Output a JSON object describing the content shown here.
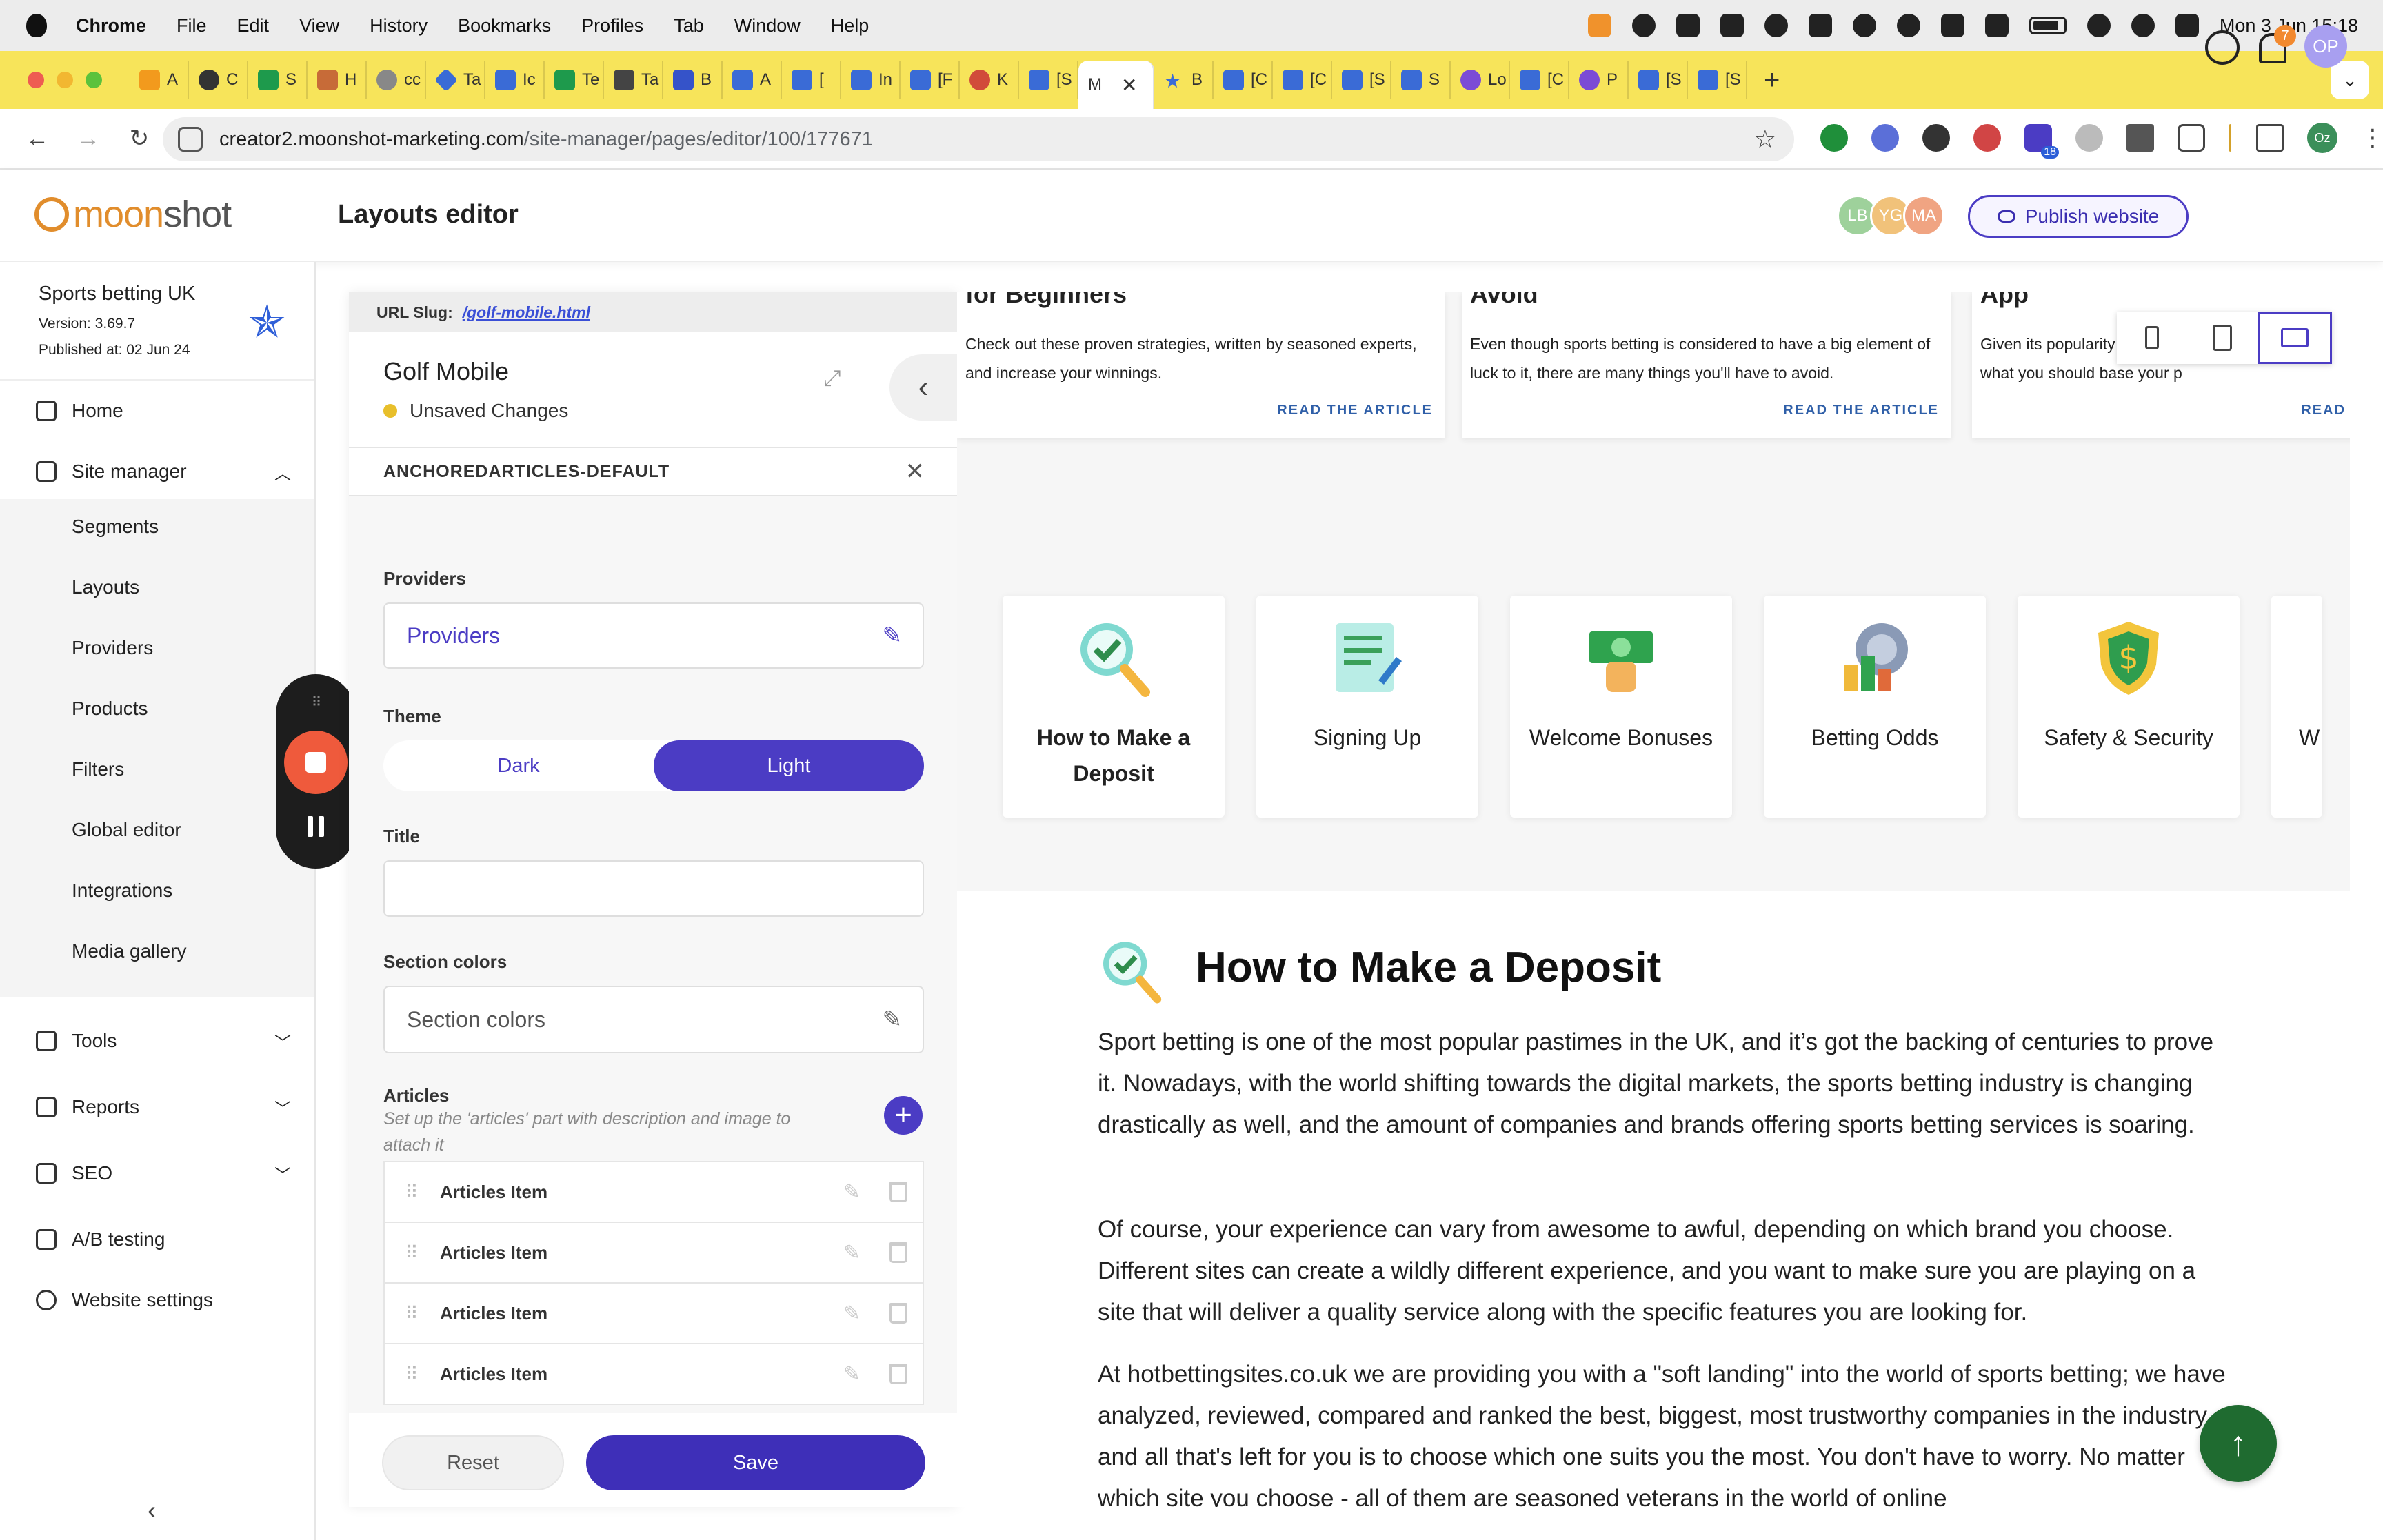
{
  "menubar": {
    "app": "Chrome",
    "items": [
      "File",
      "Edit",
      "View",
      "History",
      "Bookmarks",
      "Profiles",
      "Tab",
      "Window",
      "Help"
    ],
    "clock": "Mon 3 Jun  15:18"
  },
  "tabs": [
    {
      "label": "A",
      "icon": "bar-chart-icon"
    },
    {
      "label": "C",
      "icon": "openai-icon"
    },
    {
      "label": "S",
      "icon": "sheets-icon"
    },
    {
      "label": "H",
      "icon": "figure-icon"
    },
    {
      "label": "cc",
      "icon": "circle-icon"
    },
    {
      "label": "Ta",
      "icon": "diamond-icon"
    },
    {
      "label": "Ic",
      "icon": "jira-icon"
    },
    {
      "label": "Te",
      "icon": "sheets-icon"
    },
    {
      "label": "Ta",
      "icon": "doc-icon"
    },
    {
      "label": "B",
      "icon": "stack-icon"
    },
    {
      "label": "A",
      "icon": "jira-icon"
    },
    {
      "label": "[",
      "icon": "jira-icon"
    },
    {
      "label": "In",
      "icon": "jira-icon"
    },
    {
      "label": "[F",
      "icon": "jira-icon"
    },
    {
      "label": "K",
      "icon": "record-icon"
    },
    {
      "label": "[S",
      "icon": "jira-icon"
    },
    {
      "label": "M",
      "icon": "moonshot-icon",
      "active": true
    },
    {
      "label": "B",
      "icon": "star-icon"
    },
    {
      "label": "[C",
      "icon": "jira-icon"
    },
    {
      "label": "[C",
      "icon": "jira-icon"
    },
    {
      "label": "[S",
      "icon": "jira-icon"
    },
    {
      "label": "S",
      "icon": "jira-icon"
    },
    {
      "label": "Lo",
      "icon": "google-icon"
    },
    {
      "label": "[C",
      "icon": "jira-icon"
    },
    {
      "label": "P",
      "icon": "google-icon"
    },
    {
      "label": "[S",
      "icon": "jira-icon"
    },
    {
      "label": "[S",
      "icon": "jira-icon"
    }
  ],
  "address": {
    "host": "creator2.moonshot-marketing.com",
    "path": "/site-manager/pages/editor/100/177671"
  },
  "header": {
    "logo_a": "moon",
    "logo_b": "shot",
    "title": "Layouts editor",
    "collaborators": [
      "LB",
      "YG",
      "MA"
    ],
    "publish_label": "Publish website",
    "notifications": "7",
    "user_initials": "OP",
    "extension_badge": "18",
    "profile_chip": "Oz"
  },
  "sidebar": {
    "site_name": "Sports betting UK",
    "version": "Version: 3.69.7",
    "published": "Published at: 02 Jun 24",
    "items": {
      "home": "Home",
      "site_manager": "Site manager",
      "tools": "Tools",
      "reports": "Reports",
      "seo": "SEO",
      "ab": "A/B testing",
      "settings": "Website settings"
    },
    "sub_items": [
      "Segments",
      "Layouts",
      "Providers",
      "Products",
      "Filters",
      "Global editor",
      "Integrations",
      "Media gallery"
    ]
  },
  "editor": {
    "slug_label": "URL Slug:",
    "slug_value": "/golf-mobile.html",
    "layout_name": "Golf Mobile",
    "status": "Unsaved Changes",
    "component": "ANCHOREDARTICLES-DEFAULT",
    "providers_label": "Providers",
    "providers_value": "Providers",
    "theme_label": "Theme",
    "theme_dark": "Dark",
    "theme_light": "Light",
    "title_label": "Title",
    "title_value": "",
    "section_colors_label": "Section colors",
    "section_colors_value": "Section colors",
    "articles_label": "Articles",
    "articles_hint": "Set up the 'articles' part with description and image to attach it",
    "article_items": [
      "Articles Item",
      "Articles Item",
      "Articles Item",
      "Articles Item"
    ],
    "reset_label": "Reset",
    "save_label": "Save"
  },
  "preview": {
    "cards": [
      {
        "head": "for Beginners",
        "desc": "Check out these proven strategies, written by seasoned experts, and increase your winnings.",
        "link": "READ THE ARTICLE"
      },
      {
        "head": "Avoid",
        "desc": "Even though sports betting is considered to have a big element of luck to it, there are many things you'll have to avoid.",
        "link": "READ THE ARTICLE"
      },
      {
        "head": "App",
        "desc": "Given its popularity ... it is e Check this out to see what you should base your p",
        "link": "READ"
      }
    ],
    "categories": [
      {
        "label": "How to Make a Deposit",
        "icon": "magnifier-check-icon",
        "selected": true
      },
      {
        "label": "Signing Up",
        "icon": "form-pencil-icon"
      },
      {
        "label": "Welcome Bonuses",
        "icon": "hand-cash-icon"
      },
      {
        "label": "Betting Odds",
        "icon": "ball-chart-icon"
      },
      {
        "label": "Safety & Security",
        "icon": "dollar-shield-icon"
      },
      {
        "label": "W",
        "icon": "partial-icon"
      }
    ],
    "heading": "How to Make a Deposit",
    "paragraphs": [
      "Sport betting is one of the most popular pastimes in the UK, and it’s got the backing of centuries to prove it. Nowadays, with the world shifting towards the digital markets, the sports betting industry is changing drastically as well, and the amount of companies and brands offering sports betting services is soaring.",
      "Of course, your experience can vary from awesome to awful, depending on which brand you choose. Different sites can create a wildly different experience, and you want to make sure you are playing on a site that will deliver a quality service along with the specific features you are looking for.",
      "At hotbettingsites.co.uk we are providing you with a \"soft landing\" into the world of sports betting; we have analyzed, reviewed, compared and ranked the best, biggest, most trustworthy companies in the industry, and all that's left for you is to choose which one suits you the most. You don't have to worry. No matter which site you choose - all of them are seasoned veterans in the world of online"
    ]
  }
}
